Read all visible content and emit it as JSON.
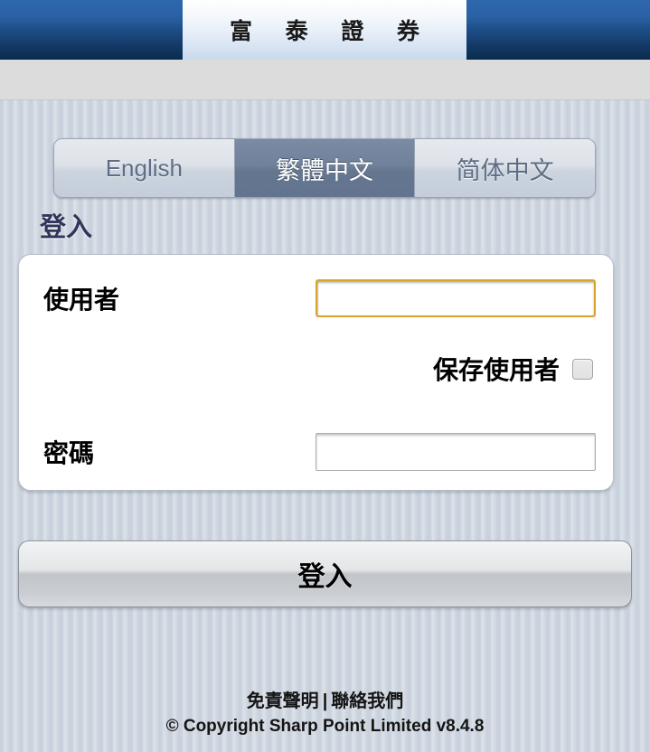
{
  "header": {
    "logo_text": "富 泰 證 券",
    "brand_blue": "#1d4c85",
    "logo_panel_bg": "#e2ebf6"
  },
  "language_tabs": {
    "selected_index": 1,
    "active_color": "#6b7b94",
    "items": [
      {
        "label": "English",
        "code": "en",
        "active": false
      },
      {
        "label": "繁體中文",
        "code": "zh-Hant",
        "active": true
      },
      {
        "label": "简体中文",
        "code": "zh-Hans",
        "active": false
      }
    ]
  },
  "login": {
    "section_title": "登入",
    "username": {
      "label": "使用者",
      "value": "",
      "placeholder": "",
      "focused": true,
      "focus_border_color": "#d8a42c"
    },
    "remember": {
      "label": "保存使用者",
      "checked": false
    },
    "password": {
      "label": "密碼",
      "value": "",
      "placeholder": "",
      "focused": false
    },
    "submit_label": "登入"
  },
  "footer": {
    "disclaimer_label": "免責聲明",
    "separator": "|",
    "contact_label": "聯絡我們",
    "copyright": "© Copyright Sharp Point Limited v8.4.8"
  }
}
